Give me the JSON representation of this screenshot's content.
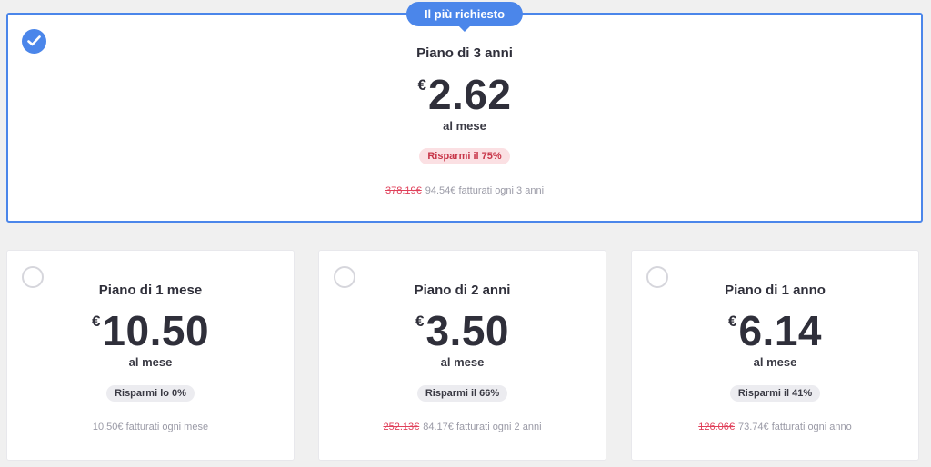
{
  "featured": {
    "badge": "Il più richiesto",
    "plan_name": "Piano di 3 anni",
    "currency": "€",
    "price": "2.62",
    "per_month": "al mese",
    "savings": "Risparmi il 75%",
    "old_price": "378.19€",
    "billing": "94.54€ fatturati ogni 3 anni",
    "selected": true
  },
  "plans": [
    {
      "plan_name": "Piano di 1 mese",
      "currency": "€",
      "price": "10.50",
      "per_month": "al mese",
      "savings": "Risparmi lo 0%",
      "old_price": "",
      "billing": "10.50€ fatturati ogni mese",
      "selected": false
    },
    {
      "plan_name": "Piano di 2 anni",
      "currency": "€",
      "price": "3.50",
      "per_month": "al mese",
      "savings": "Risparmi il 66%",
      "old_price": "252.13€",
      "billing": "84.17€ fatturati ogni 2 anni",
      "selected": false
    },
    {
      "plan_name": "Piano di 1 anno",
      "currency": "€",
      "price": "6.14",
      "per_month": "al mese",
      "savings": "Risparmi il 41%",
      "old_price": "126.06€",
      "billing": "73.74€ fatturati ogni anno",
      "selected": false
    }
  ],
  "colors": {
    "accent": "#4b86ea",
    "strike": "#e0405a",
    "save_red_bg": "#fbe0e3",
    "save_grey_bg": "#ececf0"
  },
  "icons": {
    "selected": "checkmark-icon",
    "unselected": "radio-empty-icon"
  }
}
